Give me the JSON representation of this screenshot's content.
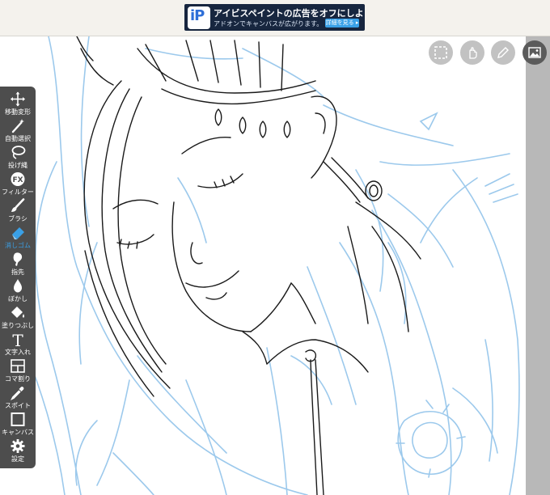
{
  "ad": {
    "title": "アイビスペイントの広告をオフにしよう!",
    "subtitle": "アドオンでキャンバスが広がります。",
    "cta": "詳細を見る ▸",
    "logo_text": "iP"
  },
  "top_buttons": [
    {
      "name": "selection-icon"
    },
    {
      "name": "hand-touch-icon"
    },
    {
      "name": "pen-icon"
    },
    {
      "name": "reference-image-icon"
    }
  ],
  "tools": [
    {
      "icon": "move-transform-icon",
      "label": "移動変形"
    },
    {
      "icon": "magic-wand-icon",
      "label": "自動選択"
    },
    {
      "icon": "lasso-icon",
      "label": "投げ縄"
    },
    {
      "icon": "filter-fx-icon",
      "label": "フィルター",
      "glyph": "FX"
    },
    {
      "icon": "brush-icon",
      "label": "ブラシ"
    },
    {
      "icon": "eraser-icon",
      "label": "消しゴム",
      "active": true
    },
    {
      "icon": "smudge-icon",
      "label": "指先"
    },
    {
      "icon": "blur-drop-icon",
      "label": "ぼかし"
    },
    {
      "icon": "fill-bucket-icon",
      "label": "塗りつぶし"
    },
    {
      "icon": "text-icon",
      "label": "文字入れ",
      "glyph": "T"
    },
    {
      "icon": "frame-divider-icon",
      "label": "コマ割り"
    },
    {
      "icon": "eyedropper-icon",
      "label": "スポイト"
    },
    {
      "icon": "canvas-icon",
      "label": "キャンバス"
    },
    {
      "icon": "settings-gear-icon",
      "label": "設定"
    }
  ],
  "colors": {
    "toolbar_bg": "#4d4d4d",
    "active_tool": "#3aa0e6",
    "sketch_blue": "#9cc9ec",
    "line_art": "#1a1a1a",
    "ad_bg": "#17263f"
  }
}
